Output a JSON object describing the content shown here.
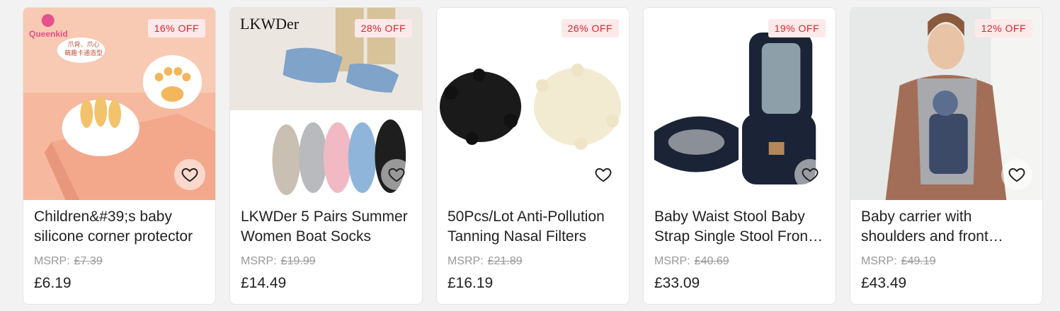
{
  "products": [
    {
      "discount": "16% OFF",
      "title": "Children&#39;s baby silicone corner protector",
      "msrp_label": "MSRP:",
      "msrp": "£7.39",
      "price": "£6.19",
      "image_text": {
        "logo": "Queenkid",
        "bubble_line1": "爪背、爪心",
        "bubble_line2": "萌趣卡通造型"
      },
      "bg_color": "#f6b9a0"
    },
    {
      "discount": "28% OFF",
      "title": "LKWDer 5 Pairs Summer Women Boat Socks",
      "msrp_label": "MSRP:",
      "msrp": "£19.99",
      "price": "£14.49",
      "image_text": {
        "brand": "LKWDer"
      },
      "bg_color": "#f1f1f1"
    },
    {
      "discount": "26% OFF",
      "title": "50Pcs/Lot Anti-Pollution Tanning Nasal Filters",
      "msrp_label": "MSRP:",
      "msrp": "£21.89",
      "price": "£16.19",
      "bg_color": "#ffffff"
    },
    {
      "discount": "19% OFF",
      "title": "Baby Waist Stool Baby Strap Single Stool Front Holding",
      "msrp_label": "MSRP:",
      "msrp": "£40.69",
      "price": "£33.09",
      "bg_color": "#ffffff"
    },
    {
      "discount": "12% OFF",
      "title": "Baby carrier with shoulders and front holding",
      "msrp_label": "MSRP:",
      "msrp": "£49.19",
      "price": "£43.49",
      "bg_color": "#e6e9e7"
    }
  ],
  "colors": {
    "discount_text": "#d8242e",
    "discount_bg": "#fde9ea"
  },
  "icons": {
    "favorite": "heart-outline-icon"
  }
}
